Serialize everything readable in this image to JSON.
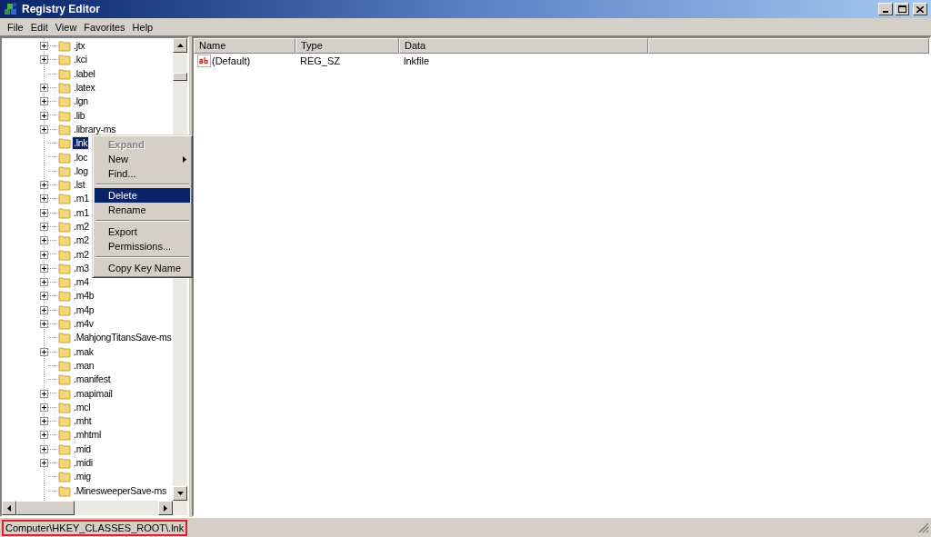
{
  "window": {
    "title": "Registry Editor"
  },
  "menu_bar": [
    "File",
    "Edit",
    "View",
    "Favorites",
    "Help"
  ],
  "tree": [
    {
      "label": ".jtx",
      "expandable": true,
      "selected": false
    },
    {
      "label": ".kci",
      "expandable": true,
      "selected": false
    },
    {
      "label": ".label",
      "expandable": false,
      "selected": false
    },
    {
      "label": ".latex",
      "expandable": true,
      "selected": false
    },
    {
      "label": ".lgn",
      "expandable": true,
      "selected": false
    },
    {
      "label": ".lib",
      "expandable": true,
      "selected": false
    },
    {
      "label": ".library-ms",
      "expandable": true,
      "selected": false
    },
    {
      "label": ".lnk",
      "expandable": false,
      "selected": true
    },
    {
      "label": ".loc",
      "expandable": false,
      "selected": false
    },
    {
      "label": ".log",
      "expandable": false,
      "selected": false
    },
    {
      "label": ".lst",
      "expandable": true,
      "selected": false
    },
    {
      "label": ".m1",
      "expandable": true,
      "selected": false
    },
    {
      "label": ".m1",
      "expandable": true,
      "selected": false
    },
    {
      "label": ".m2",
      "expandable": true,
      "selected": false
    },
    {
      "label": ".m2",
      "expandable": true,
      "selected": false
    },
    {
      "label": ".m2",
      "expandable": true,
      "selected": false
    },
    {
      "label": ".m3",
      "expandable": true,
      "selected": false
    },
    {
      "label": ".m4",
      "expandable": true,
      "selected": false
    },
    {
      "label": ".m4b",
      "expandable": true,
      "selected": false
    },
    {
      "label": ".m4p",
      "expandable": true,
      "selected": false
    },
    {
      "label": ".m4v",
      "expandable": true,
      "selected": false
    },
    {
      "label": ".MahjongTitansSave-ms",
      "expandable": false,
      "selected": false
    },
    {
      "label": ".mak",
      "expandable": true,
      "selected": false
    },
    {
      "label": ".man",
      "expandable": false,
      "selected": false
    },
    {
      "label": ".manifest",
      "expandable": false,
      "selected": false
    },
    {
      "label": ".mapimail",
      "expandable": true,
      "selected": false
    },
    {
      "label": ".mcl",
      "expandable": true,
      "selected": false
    },
    {
      "label": ".mht",
      "expandable": true,
      "selected": false
    },
    {
      "label": ".mhtml",
      "expandable": true,
      "selected": false
    },
    {
      "label": ".mid",
      "expandable": true,
      "selected": false
    },
    {
      "label": ".midi",
      "expandable": true,
      "selected": false
    },
    {
      "label": ".mig",
      "expandable": false,
      "selected": false
    },
    {
      "label": ".MinesweeperSave-ms",
      "expandable": false,
      "selected": false
    }
  ],
  "context_menu": [
    {
      "kind": "item",
      "label": "Expand",
      "disabled": true,
      "submenu": false,
      "selected": false
    },
    {
      "kind": "item",
      "label": "New",
      "disabled": false,
      "submenu": true,
      "selected": false
    },
    {
      "kind": "item",
      "label": "Find...",
      "disabled": false,
      "submenu": false,
      "selected": false
    },
    {
      "kind": "separator"
    },
    {
      "kind": "item",
      "label": "Delete",
      "disabled": false,
      "submenu": false,
      "selected": true
    },
    {
      "kind": "item",
      "label": "Rename",
      "disabled": false,
      "submenu": false,
      "selected": false
    },
    {
      "kind": "separator"
    },
    {
      "kind": "item",
      "label": "Export",
      "disabled": false,
      "submenu": false,
      "selected": false
    },
    {
      "kind": "item",
      "label": "Permissions...",
      "disabled": false,
      "submenu": false,
      "selected": false
    },
    {
      "kind": "separator"
    },
    {
      "kind": "item",
      "label": "Copy Key Name",
      "disabled": false,
      "submenu": false,
      "selected": false
    }
  ],
  "values_table": {
    "columns": [
      "Name",
      "Type",
      "Data"
    ],
    "rows": [
      {
        "name": "(Default)",
        "type": "REG_SZ",
        "data": "lnkfile"
      }
    ]
  },
  "status_bar": "Computer\\HKEY_CLASSES_ROOT\\.lnk"
}
